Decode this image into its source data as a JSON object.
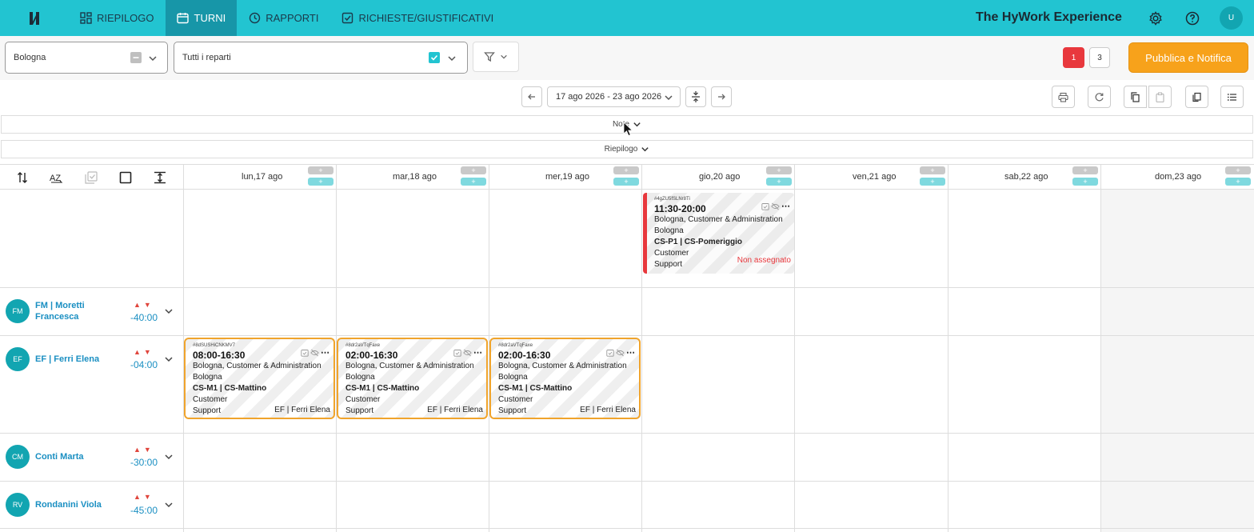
{
  "nav": {
    "logo": "И",
    "tabs": [
      {
        "label": "RIEPILOGO",
        "icon": "dashboard-icon"
      },
      {
        "label": "TURNI",
        "icon": "calendar-icon"
      },
      {
        "label": "RAPPORTI",
        "icon": "clock-icon"
      },
      {
        "label": "RICHIESTE/GIUSTIFICATIVI",
        "icon": "checkbox-icon"
      }
    ],
    "brand": "The HyWork Experience",
    "avatar": "U"
  },
  "filters": {
    "location": "Bologna",
    "department": "Tutti i reparti",
    "badge_red": "1",
    "badge_count": "3",
    "publish_label": "Pubblica e Notifica"
  },
  "toolbar": {
    "date_range": "17 ago 2026 - 23 ago 2026"
  },
  "sections": {
    "notes_label": "Note",
    "summary_label": "Riepilogo"
  },
  "days": [
    {
      "label": "lun,17 ago"
    },
    {
      "label": "mar,18 ago"
    },
    {
      "label": "mer,19 ago"
    },
    {
      "label": "gio,20 ago"
    },
    {
      "label": "ven,21 ago"
    },
    {
      "label": "sab,22 ago"
    },
    {
      "label": "dom,23 ago"
    }
  ],
  "employees": [
    {
      "initials": "FM",
      "name_line1": "FM | Moretti",
      "name_line2": "Francesca",
      "hours": "-40:00"
    },
    {
      "initials": "EF",
      "name_line1": "EF | Ferri Elena",
      "name_line2": "",
      "hours": "-04:00"
    },
    {
      "initials": "CM",
      "name_line1": "Conti Marta",
      "name_line2": "",
      "hours": "-30:00"
    },
    {
      "initials": "RV",
      "name_line1": "Rondanini Viola",
      "name_line2": "",
      "hours": "-45:00"
    }
  ],
  "unassigned_shift": {
    "id": "#4gZU5fSLNr8Ti",
    "time": "11:30-20:00",
    "location": "Bologna, Customer & Administration",
    "city": "Bologna",
    "role": "CS-P1 | CS-Pomeriggio",
    "dept1": "Customer",
    "dept2": "Support",
    "status": "Non assegnato"
  },
  "shifts": [
    {
      "id": "#8dSUSHiCNKMV7",
      "time": "08:00-16:30",
      "location": "Bologna, Customer & Administration",
      "city": "Bologna",
      "role": "CS-M1 | CS-Mattino",
      "dept1": "Customer",
      "dept2": "Support",
      "assignee": "EF | Ferri Elena"
    },
    {
      "id": "#8dr2aVTqFaxe",
      "time": "02:00-16:30",
      "location": "Bologna, Customer & Administration",
      "city": "Bologna",
      "role": "CS-M1 | CS-Mattino",
      "dept1": "Customer",
      "dept2": "Support",
      "assignee": "EF | Ferri Elena"
    },
    {
      "id": "#8dr2aVTqFaxe",
      "time": "02:00-16:30",
      "location": "Bologna, Customer & Administration",
      "city": "Bologna",
      "role": "CS-M1 | CS-Mattino",
      "dept1": "Customer",
      "dept2": "Support",
      "assignee": "EF | Ferri Elena"
    }
  ],
  "colors": {
    "topbar": "#22c4d1",
    "active_tab": "#1796a8",
    "accent_orange": "#f7a21b",
    "alert_red": "#e8383d",
    "link_blue": "#1a8fc2"
  }
}
